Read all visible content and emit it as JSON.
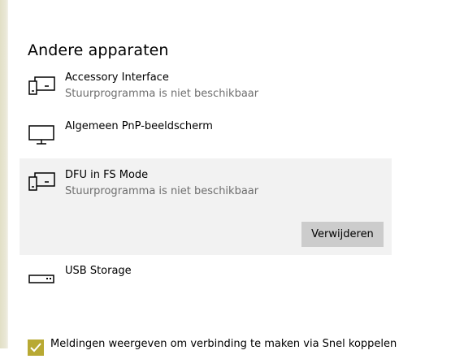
{
  "section": {
    "title": "Andere apparaten"
  },
  "devices": [
    {
      "name": "Accessory Interface",
      "status": "Stuurprogramma is niet beschikbaar",
      "icon": "devices-icon"
    },
    {
      "name": "Algemeen PnP-beeldscherm",
      "status": "",
      "icon": "monitor-icon"
    },
    {
      "name": "DFU in FS Mode",
      "status": "Stuurprogramma is niet beschikbaar",
      "icon": "devices-icon",
      "selected": true
    },
    {
      "name": "USB Storage",
      "status": "",
      "icon": "drive-icon"
    }
  ],
  "remove_button_label": "Verwijderen",
  "notify": {
    "label": "Meldingen weergeven om verbinding te maken via Snel koppelen",
    "checked": true
  },
  "colors": {
    "selected_bg": "#f2f2f2",
    "button_bg": "#cccccc",
    "status_text": "#6e6e6e",
    "checkbox": "#b8a933"
  }
}
